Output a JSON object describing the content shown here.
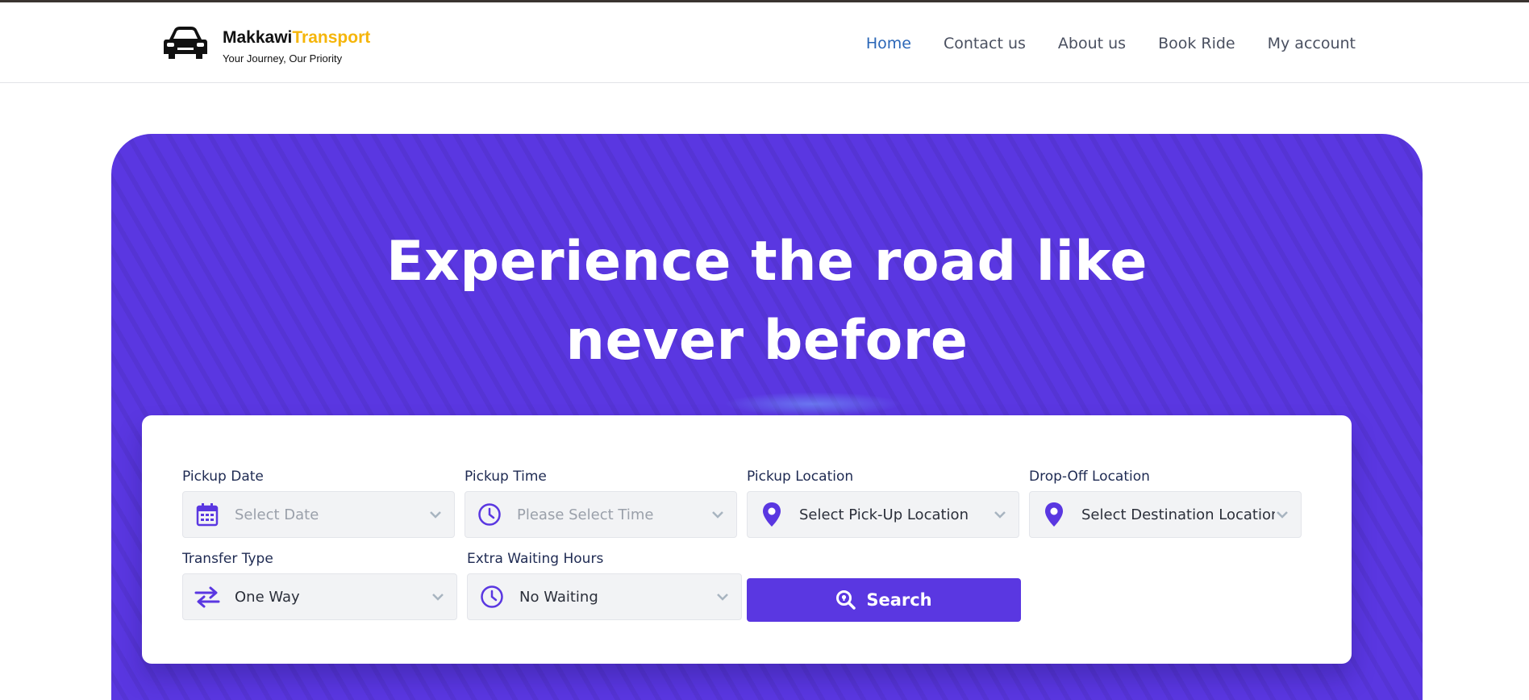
{
  "brand": {
    "name_primary": "Makkawi",
    "name_accent": "Transport",
    "tagline": "Your Journey, Our Priority",
    "logo_icon": "car-icon"
  },
  "nav": {
    "items": [
      {
        "label": "Home",
        "active": true
      },
      {
        "label": "Contact us",
        "active": false
      },
      {
        "label": "About us",
        "active": false
      },
      {
        "label": "Book Ride",
        "active": false
      },
      {
        "label": "My account",
        "active": false
      }
    ]
  },
  "hero": {
    "headline_line1": "Experience the road like",
    "headline_line2": "never before"
  },
  "form": {
    "pickup_date": {
      "label": "Pickup Date",
      "placeholder": "Select Date",
      "icon": "calendar-icon"
    },
    "pickup_time": {
      "label": "Pickup Time",
      "placeholder": "Please Select Time",
      "icon": "clock-icon"
    },
    "pickup_location": {
      "label": "Pickup Location",
      "value": "Select Pick-Up Location",
      "icon": "map-pin-icon"
    },
    "dropoff_location": {
      "label": "Drop-Off Location",
      "value": "Select Destination Location",
      "icon": "map-pin-icon"
    },
    "transfer_type": {
      "label": "Transfer Type",
      "value": "One Way",
      "icon": "swap-arrows-icon"
    },
    "extra_waiting": {
      "label": "Extra Waiting Hours",
      "value": "No Waiting",
      "icon": "clock-icon"
    },
    "search_label": "Search"
  },
  "colors": {
    "accent": "#5a37e1",
    "brand_yellow": "#f5b50a",
    "nav_active": "#2a66b7",
    "label_text": "#1e2a52"
  }
}
